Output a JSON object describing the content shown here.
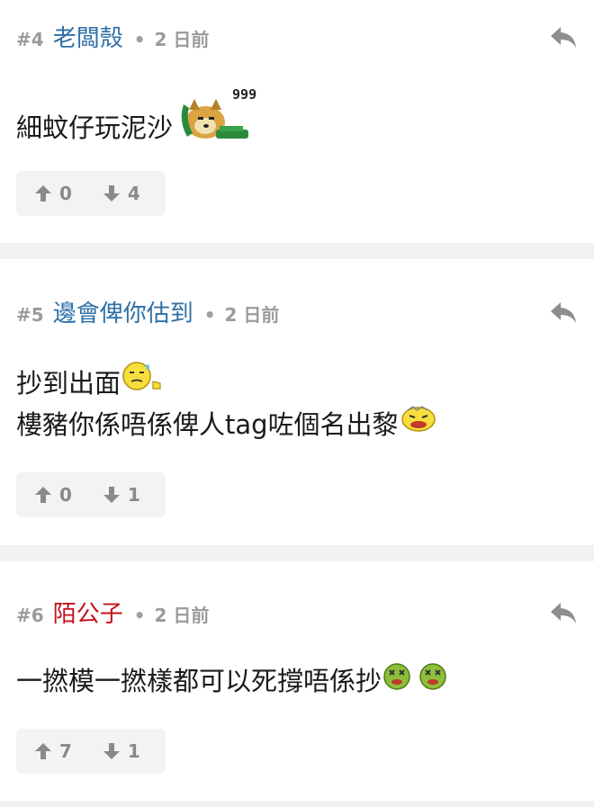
{
  "posts": [
    {
      "number": "#4",
      "author": "老闆殼",
      "time": "2 日前",
      "lines": [
        "細蚊仔玩泥沙"
      ],
      "emoji_note": "999",
      "upvotes": "0",
      "downvotes": "4"
    },
    {
      "number": "#5",
      "author": "邊會俾你估到",
      "time": "2 日前",
      "lines": [
        "抄到出面",
        "樓豬你係唔係俾人tag咗個名出黎"
      ],
      "upvotes": "0",
      "downvotes": "1"
    },
    {
      "number": "#6",
      "author": "陌公子",
      "time": "2 日前",
      "lines": [
        "一撚模一撚樣都可以死撐唔係抄"
      ],
      "upvotes": "7",
      "downvotes": "1"
    }
  ],
  "separator": "•",
  "colors": {
    "author_default": "#2f6fa7",
    "author_highlight": "#c4111d",
    "muted": "#9b9b9b",
    "page_bg": "#f2f2f2"
  },
  "icons": [
    "reply-icon",
    "thumb-up-arrow-icon",
    "thumb-down-arrow-icon",
    "dog-phone-emoji",
    "sweat-thumb-emoji",
    "vomit-emoji",
    "sick-face-emoji"
  ]
}
